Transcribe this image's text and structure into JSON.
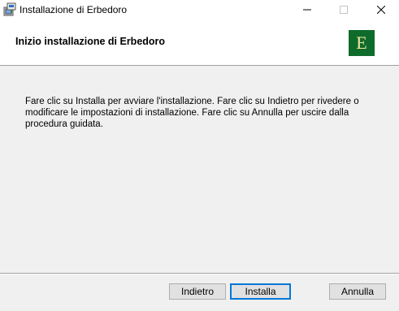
{
  "window": {
    "title": "Installazione di Erbedoro",
    "icons": {
      "app": "installer-package-icon",
      "minimize": "minimize-icon",
      "maximize": "maximize-icon",
      "close": "close-icon"
    }
  },
  "banner": {
    "title": "Inizio installazione di Erbedoro",
    "logo_letter": "E",
    "logo_color": "#0f6b2c",
    "logo_letter_color": "#f2e49c"
  },
  "body": {
    "message": "Fare clic su Installa per avviare l'installazione. Fare clic su Indietro per rivedere o modificare le impostazioni di installazione. Fare clic su Annulla per uscire dalla procedura guidata."
  },
  "buttons": {
    "back": "Indietro",
    "install": "Installa",
    "cancel": "Annulla",
    "focus_color": "#0078d7"
  }
}
